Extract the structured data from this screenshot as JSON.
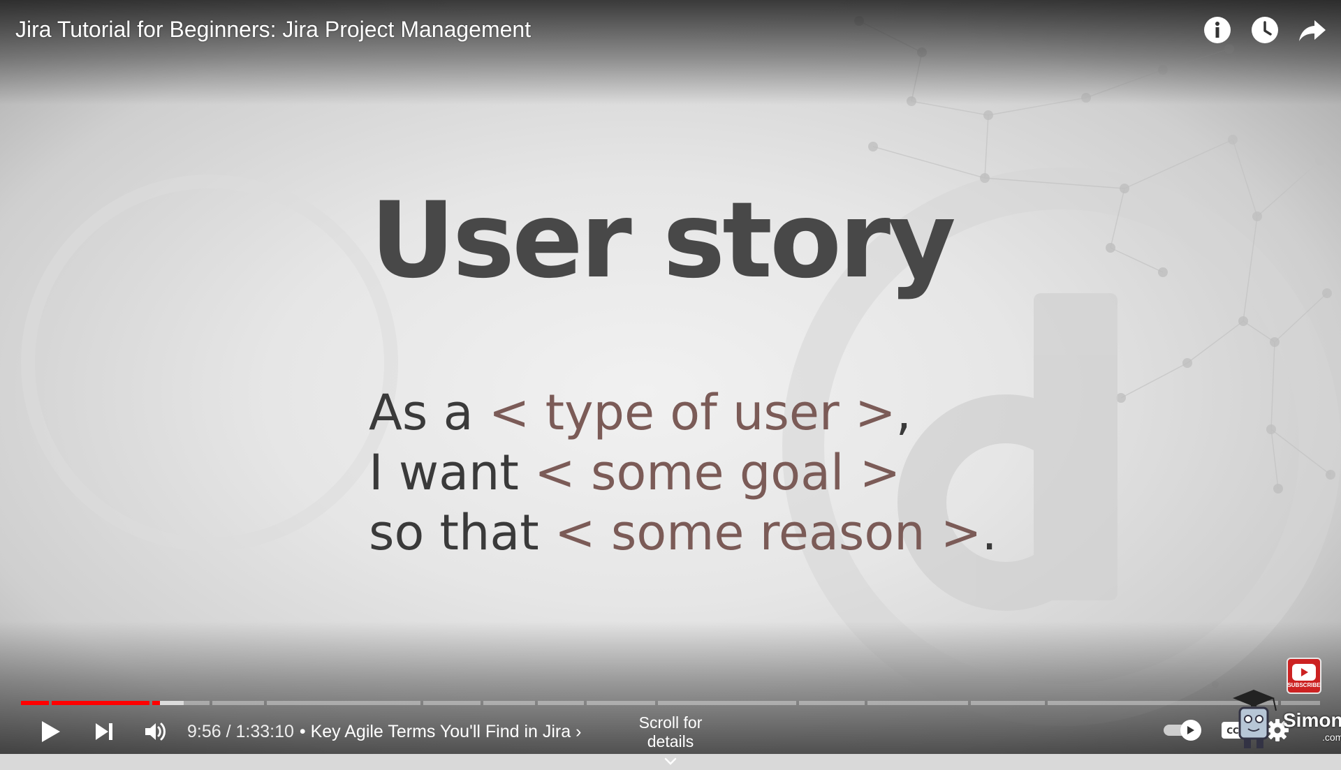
{
  "header": {
    "video_title": "Jira Tutorial for Beginners: Jira Project Management",
    "actions": [
      {
        "icon": "info-icon"
      },
      {
        "icon": "watch-later-icon"
      },
      {
        "icon": "share-icon"
      }
    ]
  },
  "slide": {
    "title": "User story",
    "line1_prefix": "As a ",
    "line1_placeholder": "< type of user >",
    "line1_suffix": ",",
    "line2_prefix": "I want ",
    "line2_placeholder": "< some goal >",
    "line3_prefix": "so that ",
    "line3_placeholder": "< some reason >",
    "line3_suffix": ".",
    "placeholder_color": "#7b5b57"
  },
  "player": {
    "current_time": "9:56",
    "duration": "1:33:10",
    "time_text": "9:56 / 1:33:10",
    "chapter_text": "• Key Agile Terms You'll Find in Jira",
    "scroll_hint": "Scroll for details",
    "played_fraction": 0.107,
    "buffered_fraction": 0.128,
    "accent_color": "#ff0000"
  },
  "overlay": {
    "subscribe_text": "SUBSCRIBE",
    "brand_name": "Simon",
    "brand_domain": ".com"
  }
}
